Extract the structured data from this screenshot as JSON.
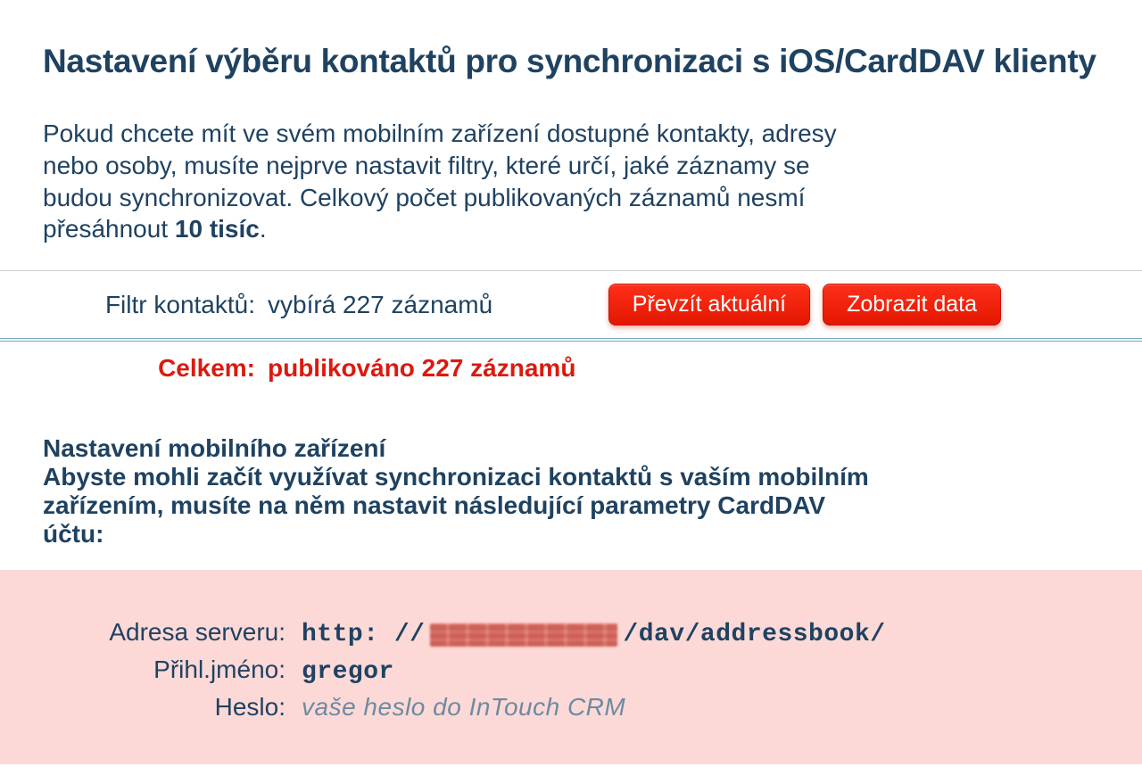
{
  "heading": "Nastavení výběru kontaktů pro synchronizaci s iOS/CardDAV klienty",
  "intro_pre": "Pokud chcete mít ve svém mobilním zařízení dostupné kontakty, adresy nebo osoby, musíte nejprve nastavit filtry, které určí, jaké záznamy se budou synchronizovat. Celkový počet publikovaných záznamů nesmí přesáhnout ",
  "intro_bold": "10 tisíc",
  "intro_post": ".",
  "filter_row": {
    "label": "Filtr kontaktů:",
    "value": "vybírá 227 záznamů",
    "btn_takeover": "Převzít aktuální",
    "btn_showdata": "Zobrazit data"
  },
  "total_row": {
    "label": "Celkem:",
    "value": "publikováno 227 záznamů"
  },
  "device_section": {
    "title_line1": "Nastavení mobilního zařízení",
    "title_rest": "Abyste mohli začít využívat synchronizaci kontaktů s vaším mobilním zařízením, musíte na něm nastavit následující parametry CardDAV účtu:"
  },
  "params": {
    "server_label": "Adresa serveru:",
    "server_pre": "http: //",
    "server_post": "/dav/addressbook/",
    "login_label": "Přihl.jméno:",
    "login_value": "gregor",
    "password_label": "Heslo:",
    "password_value": "vaše heslo do InTouch CRM"
  }
}
